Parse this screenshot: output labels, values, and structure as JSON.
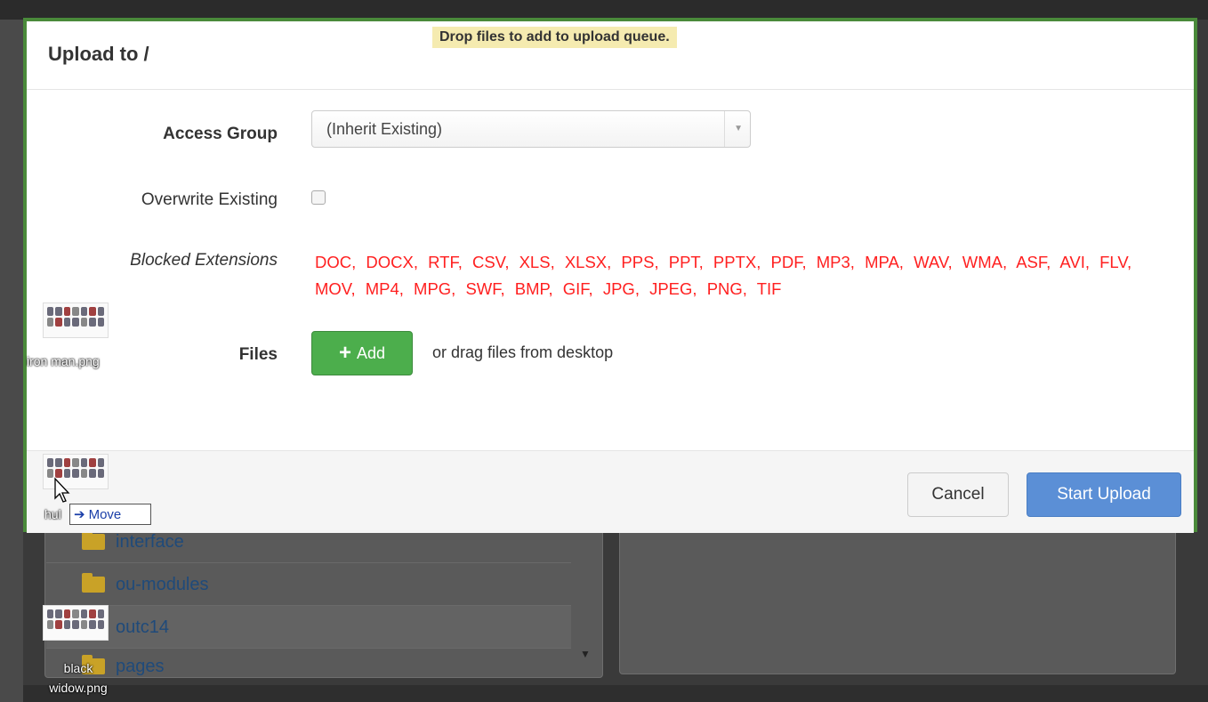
{
  "modal": {
    "title": "Upload to /",
    "drop_banner": "Drop files to add to upload queue.",
    "access_group": {
      "label": "Access Group",
      "selected": "(Inherit Existing)"
    },
    "overwrite": {
      "label": "Overwrite Existing",
      "checked": false
    },
    "blocked": {
      "label": "Blocked Extensions",
      "extensions": "DOC, DOCX, RTF, CSV, XLS, XLSX, PPS, PPT, PPTX, PDF, MP3, MPA, WAV, WMA, ASF, AVI, FLV, MOV, MP4, MPG, SWF, BMP, GIF, JPG, JPEG, PNG, TIF"
    },
    "files": {
      "label": "Files",
      "add_label": "Add",
      "drag_text": "or drag files from desktop"
    },
    "footer": {
      "cancel_label": "Cancel",
      "start_label": "Start Upload"
    }
  },
  "background_list": [
    {
      "name": "interface"
    },
    {
      "name": "ou-modules"
    },
    {
      "name": "outc14"
    },
    {
      "name": "pages"
    }
  ],
  "desktop_files": [
    {
      "name": "iron man.png"
    },
    {
      "name": "hul"
    },
    {
      "name": "black\nwidow.png"
    }
  ],
  "drag_tooltip": "Move",
  "colors": {
    "modal_border": "#4a8a3a",
    "blocked_ext": "#ff2020",
    "add_button": "#4cae4c",
    "start_button": "#5b8fd6",
    "drop_banner": "#f5ebb0"
  }
}
